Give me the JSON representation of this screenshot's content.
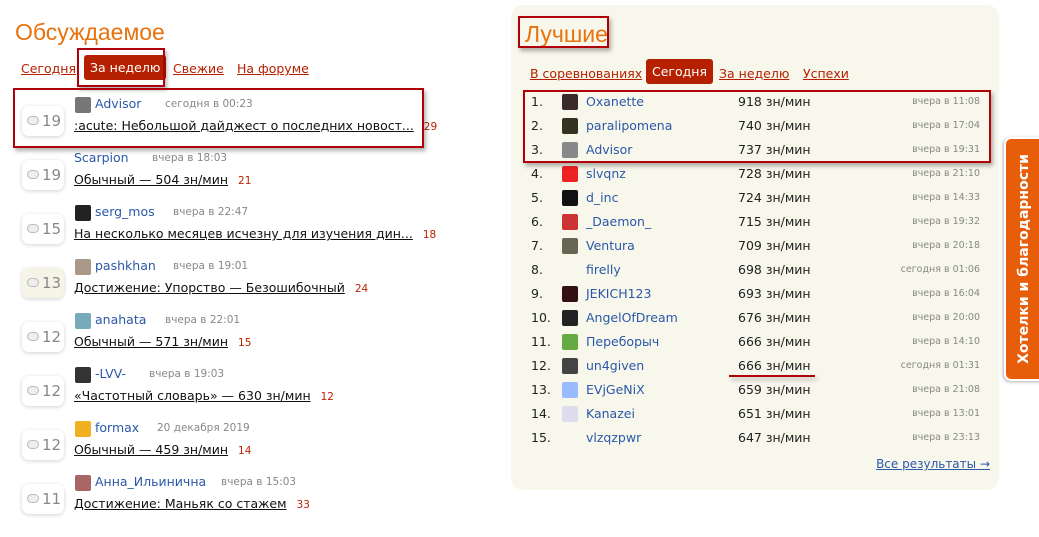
{
  "discussed": {
    "title": "Обсуждаемое",
    "tabs": [
      "Сегодня",
      "За неделю",
      "Свежие",
      "На форуме"
    ],
    "active_tab": 1,
    "items": [
      {
        "comments": "19",
        "user": "Advisor",
        "time": "сегодня в 00:23",
        "title": ":acute: Небольшой дайджест о последних новост...",
        "count": "29",
        "avatar": "#777"
      },
      {
        "comments": "19",
        "user": "Scarpion",
        "time": "вчера в 18:03",
        "title": "Обычный — 504 зн/мин",
        "count": "21",
        "avatar": ""
      },
      {
        "comments": "15",
        "user": "serg_mos",
        "time": "вчера в 22:47",
        "title": "На несколько месяцев исчезну для изучения дин...",
        "count": "18",
        "avatar": "#222"
      },
      {
        "comments": "13",
        "user": "pashkhan",
        "time": "вчера в 19:01",
        "title": "Достижение: Упорство — Безошибочный",
        "count": "24",
        "avatar": "#a98",
        "hl": true
      },
      {
        "comments": "12",
        "user": "anahata",
        "time": "вчера в 22:01",
        "title": "Обычный — 571 зн/мин",
        "count": "15",
        "avatar": "#7ab"
      },
      {
        "comments": "12",
        "user": "-LVV-",
        "time": "вчера в 19:03",
        "title": "«Частотный словарь» — 630 зн/мин",
        "count": "12",
        "avatar": "#333"
      },
      {
        "comments": "12",
        "user": "formax",
        "time": "20 декабря 2019",
        "title": "Обычный — 459 зн/мин",
        "count": "14",
        "avatar": "#f0b020"
      },
      {
        "comments": "11",
        "user": "Анна_Ильинична",
        "time": "вчера в 15:03",
        "title": "Достижение: Маньяк со стажем",
        "count": "33",
        "avatar": "#a66"
      }
    ]
  },
  "best": {
    "title": "Лучшие",
    "tabs": [
      "В соревнованиях",
      "Сегодня",
      "За неделю",
      "Успехи"
    ],
    "active_tab": 1,
    "rows": [
      {
        "rank": "1.",
        "user": "Oxanette",
        "speed": "918 зн/мин",
        "time": "вчера в 11:08",
        "avatar": "#3a2a2a"
      },
      {
        "rank": "2.",
        "user": "paralipomena",
        "speed": "740 зн/мин",
        "time": "вчера в 17:04",
        "avatar": "#332"
      },
      {
        "rank": "3.",
        "user": "Advisor",
        "speed": "737 зн/мин",
        "time": "вчера в 19:31",
        "avatar": "#888"
      },
      {
        "rank": "4.",
        "user": "slvqnz",
        "speed": "728 зн/мин",
        "time": "вчера в 21:10",
        "avatar": "#e22"
      },
      {
        "rank": "5.",
        "user": "d_inc",
        "speed": "724 зн/мин",
        "time": "вчера в 14:33",
        "avatar": "#111"
      },
      {
        "rank": "6.",
        "user": "_Daemon_",
        "speed": "715 зн/мин",
        "time": "вчера в 19:32",
        "avatar": "#c33"
      },
      {
        "rank": "7.",
        "user": "Ventura",
        "speed": "709 зн/мин",
        "time": "вчера в 20:18",
        "avatar": "#665"
      },
      {
        "rank": "8.",
        "user": "firelly",
        "speed": "698 зн/мин",
        "time": "сегодня в 01:06",
        "avatar": ""
      },
      {
        "rank": "9.",
        "user": "JEKICH123",
        "speed": "693 зн/мин",
        "time": "вчера в 16:04",
        "avatar": "#311"
      },
      {
        "rank": "10.",
        "user": "AngelOfDream",
        "speed": "676 зн/мин",
        "time": "вчера в 20:00",
        "avatar": "#222"
      },
      {
        "rank": "11.",
        "user": "Переборыч",
        "speed": "666 зн/мин",
        "time": "вчера в 14:10",
        "avatar": "#6a4"
      },
      {
        "rank": "12.",
        "user": "un4given",
        "speed": "666 зн/мин",
        "time": "сегодня в 01:31",
        "avatar": "#444"
      },
      {
        "rank": "13.",
        "user": "EVjGeNiX",
        "speed": "659 зн/мин",
        "time": "вчера в 21:08",
        "avatar": "#9bf"
      },
      {
        "rank": "14.",
        "user": "Kanazei",
        "speed": "651 зн/мин",
        "time": "вчера в 13:01",
        "avatar": "#dde"
      },
      {
        "rank": "15.",
        "user": "vlzqzpwr",
        "speed": "647 зн/мин",
        "time": "вчера в 23:13",
        "avatar": ""
      }
    ],
    "all_results": "Все результаты →"
  },
  "side_tab": "Хотелки и благодарности"
}
